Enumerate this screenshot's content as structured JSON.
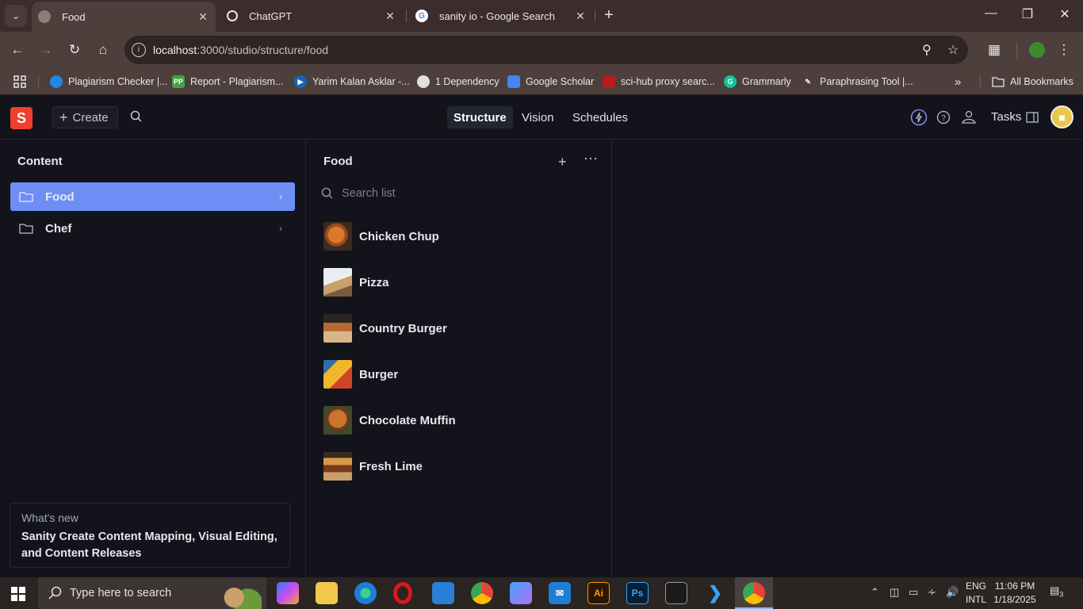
{
  "browser": {
    "tabs": [
      {
        "title": "Food",
        "favicon": "sanity-favicon",
        "active": true
      },
      {
        "title": "ChatGPT",
        "favicon": "chatgpt-favicon",
        "active": false
      },
      {
        "title": "sanity io - Google Search",
        "favicon": "google-favicon",
        "active": false
      }
    ],
    "url_host": "localhost",
    "url_rest": ":3000/studio/structure/food",
    "bookmarks": [
      {
        "label": "Plagiarism Checker |...",
        "color": "#1e88e5"
      },
      {
        "label": "Report - Plagiarism...",
        "color": "#43a047",
        "badge": "PP"
      },
      {
        "label": "Yarim Kalan Asklar -...",
        "color": "#1565c0"
      },
      {
        "label": "1 Dependency",
        "color": "#e0e0e0"
      },
      {
        "label": "Google Scholar",
        "color": "#4285f4"
      },
      {
        "label": "sci-hub proxy searc...",
        "color": "#b71c1c"
      },
      {
        "label": "Grammarly",
        "color": "#15c39a",
        "badge": "G"
      },
      {
        "label": "Paraphrasing Tool |...",
        "color": "#9e9e9e"
      }
    ],
    "all_bookmarks": "All Bookmarks"
  },
  "studio": {
    "logo": "S",
    "create_label": "Create",
    "nav_tabs": [
      "Structure",
      "Vision",
      "Schedules"
    ],
    "tasks_label": "Tasks",
    "accent": "#6e8ef6"
  },
  "content_pane": {
    "title": "Content",
    "items": [
      {
        "label": "Food",
        "selected": true
      },
      {
        "label": "Chef",
        "selected": false
      }
    ]
  },
  "whats_new": {
    "subtitle": "What's new",
    "title": "Sanity Create Content Mapping, Visual Editing, and Content Releases"
  },
  "food_pane": {
    "title": "Food",
    "search_placeholder": "Search list",
    "documents": [
      {
        "name": "Chicken Chup"
      },
      {
        "name": "Pizza"
      },
      {
        "name": "Country Burger"
      },
      {
        "name": "Burger"
      },
      {
        "name": "Chocolate Muffin"
      },
      {
        "name": "Fresh Lime"
      }
    ]
  },
  "taskbar": {
    "search_placeholder": "Type here to search",
    "lang_line1": "ENG",
    "lang_line2": "INTL",
    "time": "11:06 PM",
    "date": "1/18/2025",
    "notifications": "3"
  }
}
